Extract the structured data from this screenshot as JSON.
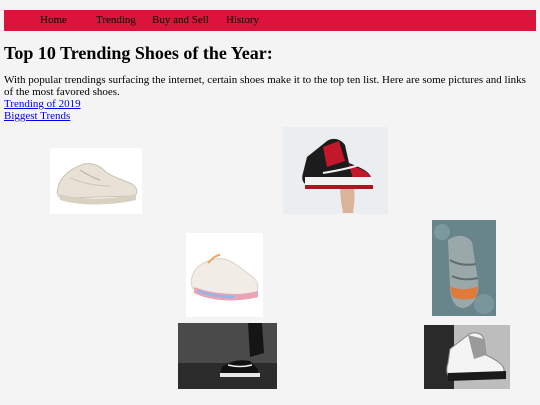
{
  "nav": {
    "items": [
      "Home",
      "Trending",
      "Buy and Sell",
      "History"
    ]
  },
  "page": {
    "title": "Top 10 Trending Shoes of the Year:",
    "intro": "With popular trendings surfacing the internet, certain shoes make it to the top ten list. Here are some pictures and links of the most favored shoes."
  },
  "links": [
    "Trending of 2019",
    "Biggest Trends"
  ],
  "colors": {
    "nav_background": "#dc143c",
    "page_background": "#f4f4f4",
    "link": "#0000ee"
  }
}
